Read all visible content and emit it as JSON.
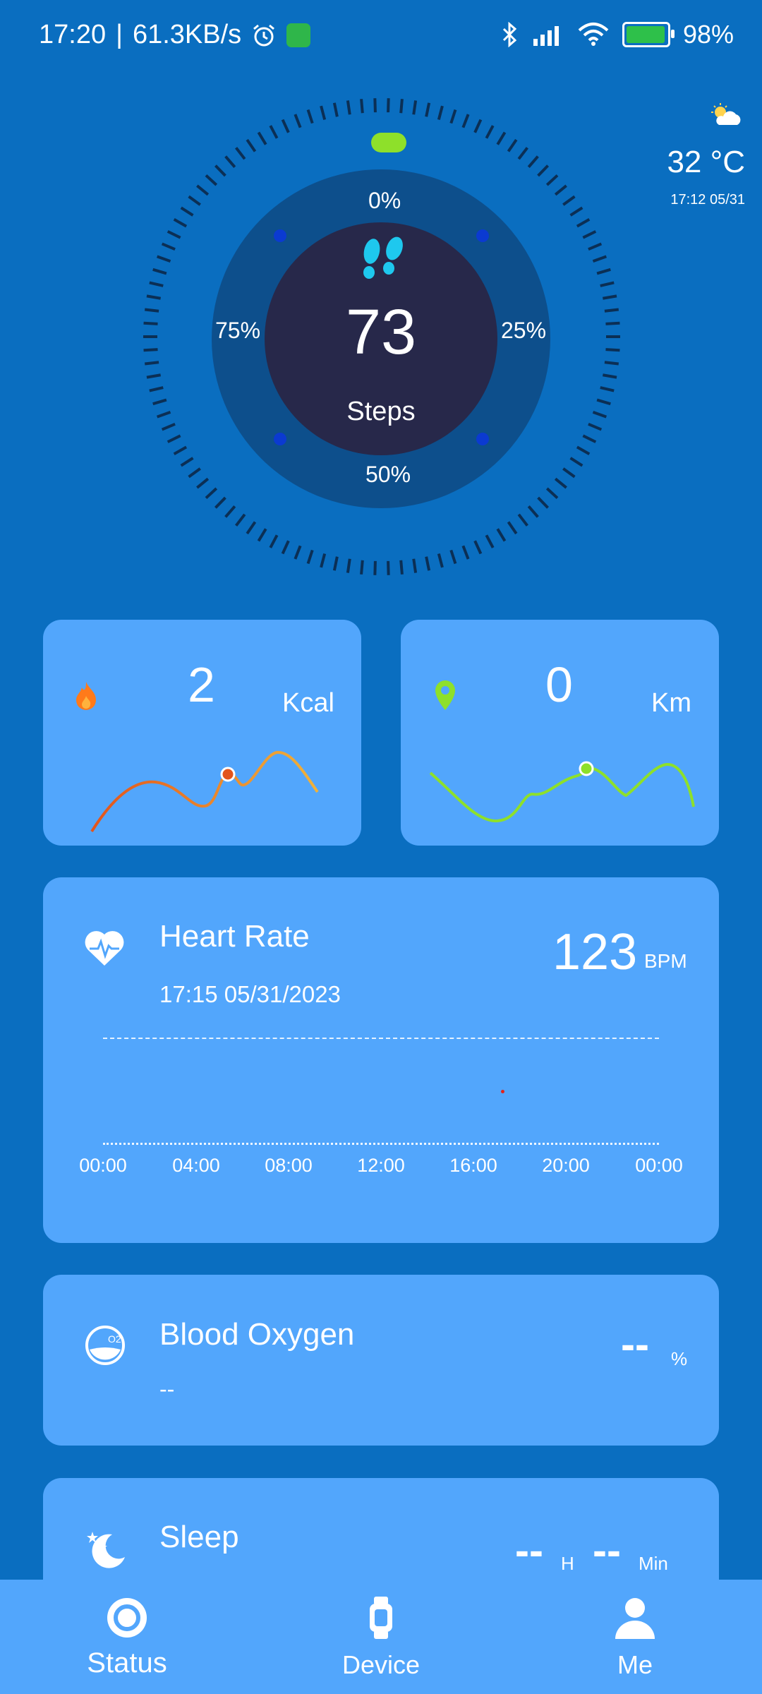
{
  "status_bar": {
    "time": "17:20",
    "speed": "61.3KB/s",
    "battery": "98%"
  },
  "steps": {
    "value": "73",
    "label": "Steps",
    "pct_top": "0%",
    "pct_right": "25%",
    "pct_bottom": "50%",
    "pct_left": "75%"
  },
  "weather": {
    "temp": "32 °C",
    "time": "17:12 05/31"
  },
  "calories": {
    "value": "2",
    "unit": "Kcal"
  },
  "distance": {
    "value": "0",
    "unit": "Km"
  },
  "heart_rate": {
    "title": "Heart Rate",
    "date": "17:15 05/31/2023",
    "value": "123",
    "unit": "BPM",
    "axis": [
      "00:00",
      "04:00",
      "08:00",
      "12:00",
      "16:00",
      "20:00",
      "00:00"
    ]
  },
  "blood_oxygen": {
    "title": "Blood Oxygen",
    "subtitle": "--",
    "value": "--",
    "unit": "%"
  },
  "sleep": {
    "title": "Sleep",
    "hours": "--",
    "hours_unit": "H",
    "minutes": "--",
    "minutes_unit": "Min"
  },
  "nav": {
    "status": "Status",
    "device": "Device",
    "me": "Me"
  }
}
